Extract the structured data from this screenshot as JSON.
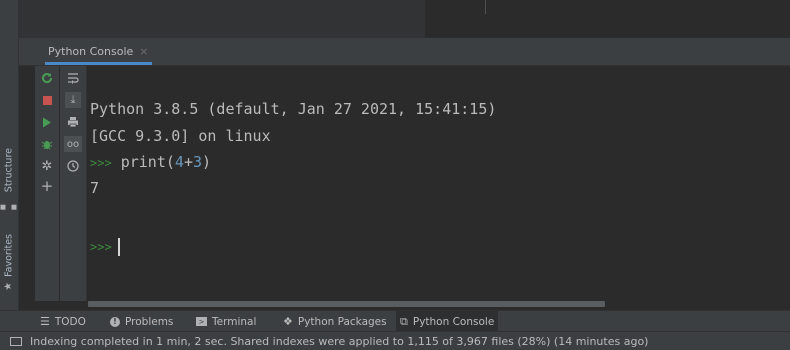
{
  "left_bar": {
    "structure_label": "Structure",
    "favorites_label": "Favorites"
  },
  "panel": {
    "tab_label": "Python Console",
    "tab_close": "×"
  },
  "console": {
    "lines": [
      "Python 3.8.5 (default, Jan 27 2021, 15:41:15)",
      "[GCC 9.3.0] on linux"
    ],
    "input_prompt": ">>>",
    "input_print": "print(",
    "input_num1": "4",
    "input_plus": "+",
    "input_num2": "3",
    "input_close": ")",
    "output": "7",
    "active_prompt": ">>>"
  },
  "bottom_tabs": [
    {
      "label": "TODO",
      "icon": "list-icon"
    },
    {
      "label": "Problems",
      "icon": "problems-icon"
    },
    {
      "label": "Terminal",
      "icon": "terminal-icon"
    },
    {
      "label": "Python Packages",
      "icon": "packages-icon"
    },
    {
      "label": "Python Console",
      "icon": "python-icon"
    }
  ],
  "status": {
    "text": "Indexing completed in 1 min, 2 sec. Shared indexes were applied to 1,115 of 3,967 files (28%) (14 minutes ago)"
  },
  "colors": {
    "accent": "#4a88c7",
    "prompt_green": "#3d8c40",
    "number_blue": "#6897bb",
    "rerun_green": "#499c54",
    "stop_red": "#c75450"
  }
}
